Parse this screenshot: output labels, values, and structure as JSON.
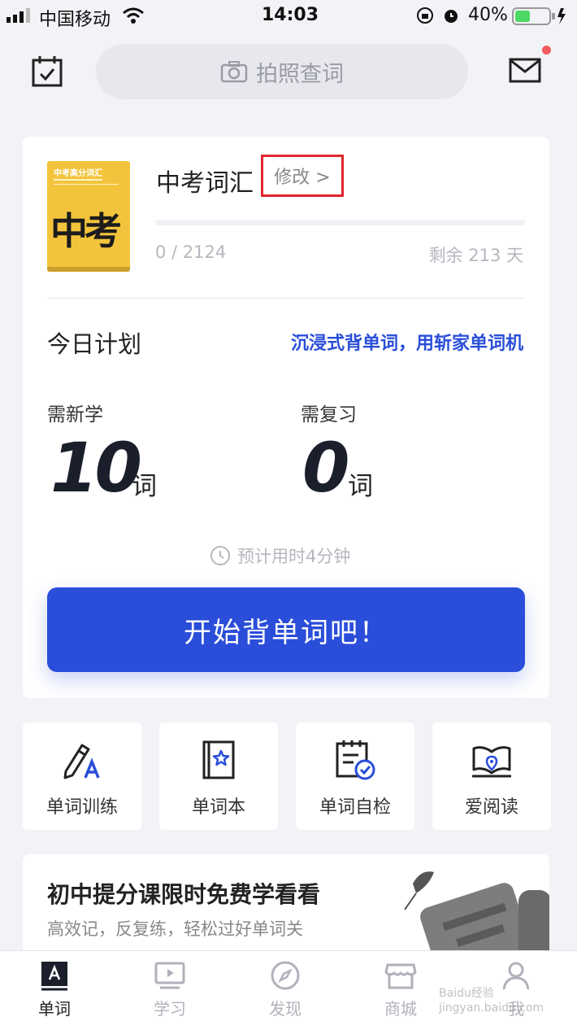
{
  "status_bar": {
    "carrier": "中国移动",
    "time": "14:03",
    "battery": "40%"
  },
  "header": {
    "search_placeholder": "拍照查词"
  },
  "book": {
    "cover_title": "中考高分词汇",
    "cover_big": "中考",
    "name": "中考词汇",
    "modify_label": "修改 >",
    "progress_text": "0 / 2124",
    "progress_value": 0,
    "remaining": "剩余 213 天"
  },
  "plan": {
    "title": "今日计划",
    "link": "沉浸式背单词，用斩家单词机",
    "new_label": "需新学",
    "new_count": "10",
    "new_unit": "词",
    "review_label": "需复习",
    "review_count": "0",
    "review_unit": "词",
    "estimate": "预计用时4分钟",
    "start_button": "开始背单词吧！"
  },
  "tools": [
    {
      "label": "单词训练",
      "icon": "pencil-a-icon"
    },
    {
      "label": "单词本",
      "icon": "wordbook-star-icon"
    },
    {
      "label": "单词自检",
      "icon": "calendar-check-icon"
    },
    {
      "label": "爱阅读",
      "icon": "open-book-icon"
    }
  ],
  "promo": {
    "title": "初中提分课限时免费学看看",
    "subtitle": "高效记，反复练，轻松过好单词关"
  },
  "tabs": [
    {
      "label": "单词",
      "icon": "word-a-icon",
      "active": true
    },
    {
      "label": "学习",
      "icon": "video-screen-icon",
      "active": false
    },
    {
      "label": "发现",
      "icon": "compass-icon",
      "active": false
    },
    {
      "label": "商城",
      "icon": "store-icon",
      "active": false
    },
    {
      "label": "我",
      "icon": "profile-icon",
      "active": false
    }
  ],
  "watermark": "Baidu经验 jingyan.baidu.com",
  "colors": {
    "accent": "#2a4ed9",
    "highlight_box": "#e0262c",
    "book_yellow": "#f3c43b"
  }
}
